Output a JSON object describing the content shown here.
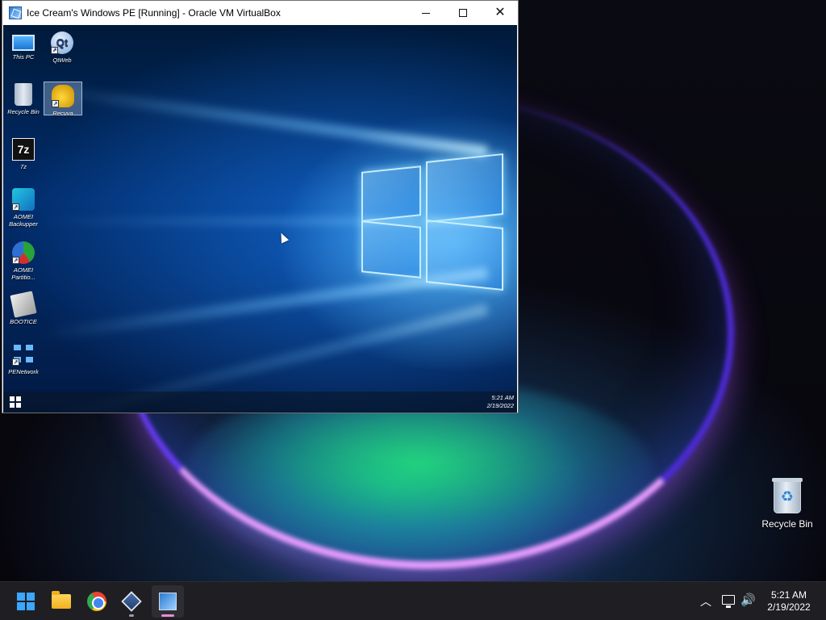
{
  "vbox_window": {
    "title": "Ice Cream's Windows PE [Running] - Oracle VM VirtualBox",
    "controls": {
      "minimize_icon": "minimize-icon",
      "maximize_icon": "maximize-icon",
      "close_glyph": "✕"
    }
  },
  "guest": {
    "desktop_icons": [
      {
        "label": "This PC",
        "icon": "this-pc-icon"
      },
      {
        "label": "QtWeb",
        "icon": "qtweb-icon"
      },
      {
        "label": "Recycle Bin",
        "icon": "recycle-bin-icon"
      },
      {
        "label": "Recuva",
        "icon": "recuva-icon",
        "selected": true
      },
      {
        "label": "7z",
        "icon": "7zip-icon",
        "glyph": "7z"
      },
      {
        "label": "AOMEI Backupper",
        "icon": "aomei-backupper-icon"
      },
      {
        "label": "AOMEI Partitio...",
        "icon": "aomei-partition-icon"
      },
      {
        "label": "BOOTICE",
        "icon": "bootice-icon"
      },
      {
        "label": "PENetwork",
        "icon": "penetwork-icon"
      }
    ],
    "qtweb_glyph": "Qt",
    "shortcut_glyph": "↗",
    "clock": {
      "time": "5:21 AM",
      "date": "2/19/2022"
    }
  },
  "host": {
    "desktop_icons": [
      {
        "label": "Recycle Bin",
        "icon": "recycle-bin-icon",
        "glyph": "♻"
      }
    ],
    "taskbar": {
      "apps": [
        {
          "name": "Start",
          "icon": "windows-start-icon"
        },
        {
          "name": "File Explorer",
          "icon": "folder-icon"
        },
        {
          "name": "Google Chrome",
          "icon": "chrome-icon"
        },
        {
          "name": "Oracle VM VirtualBox Manager",
          "icon": "virtualbox-icon"
        },
        {
          "name": "Ice Cream's Windows PE [Running] - Oracle VM VirtualBox",
          "icon": "virtualbox-vm-icon",
          "active": true
        }
      ],
      "tray": {
        "chevron_glyph": "︿",
        "volume_glyph": "🔊",
        "time": "5:21 AM",
        "date": "2/19/2022"
      }
    },
    "accent_colors": {
      "win11_blue": "#3ba7ff",
      "active_indicator": "#e98ad8"
    }
  }
}
